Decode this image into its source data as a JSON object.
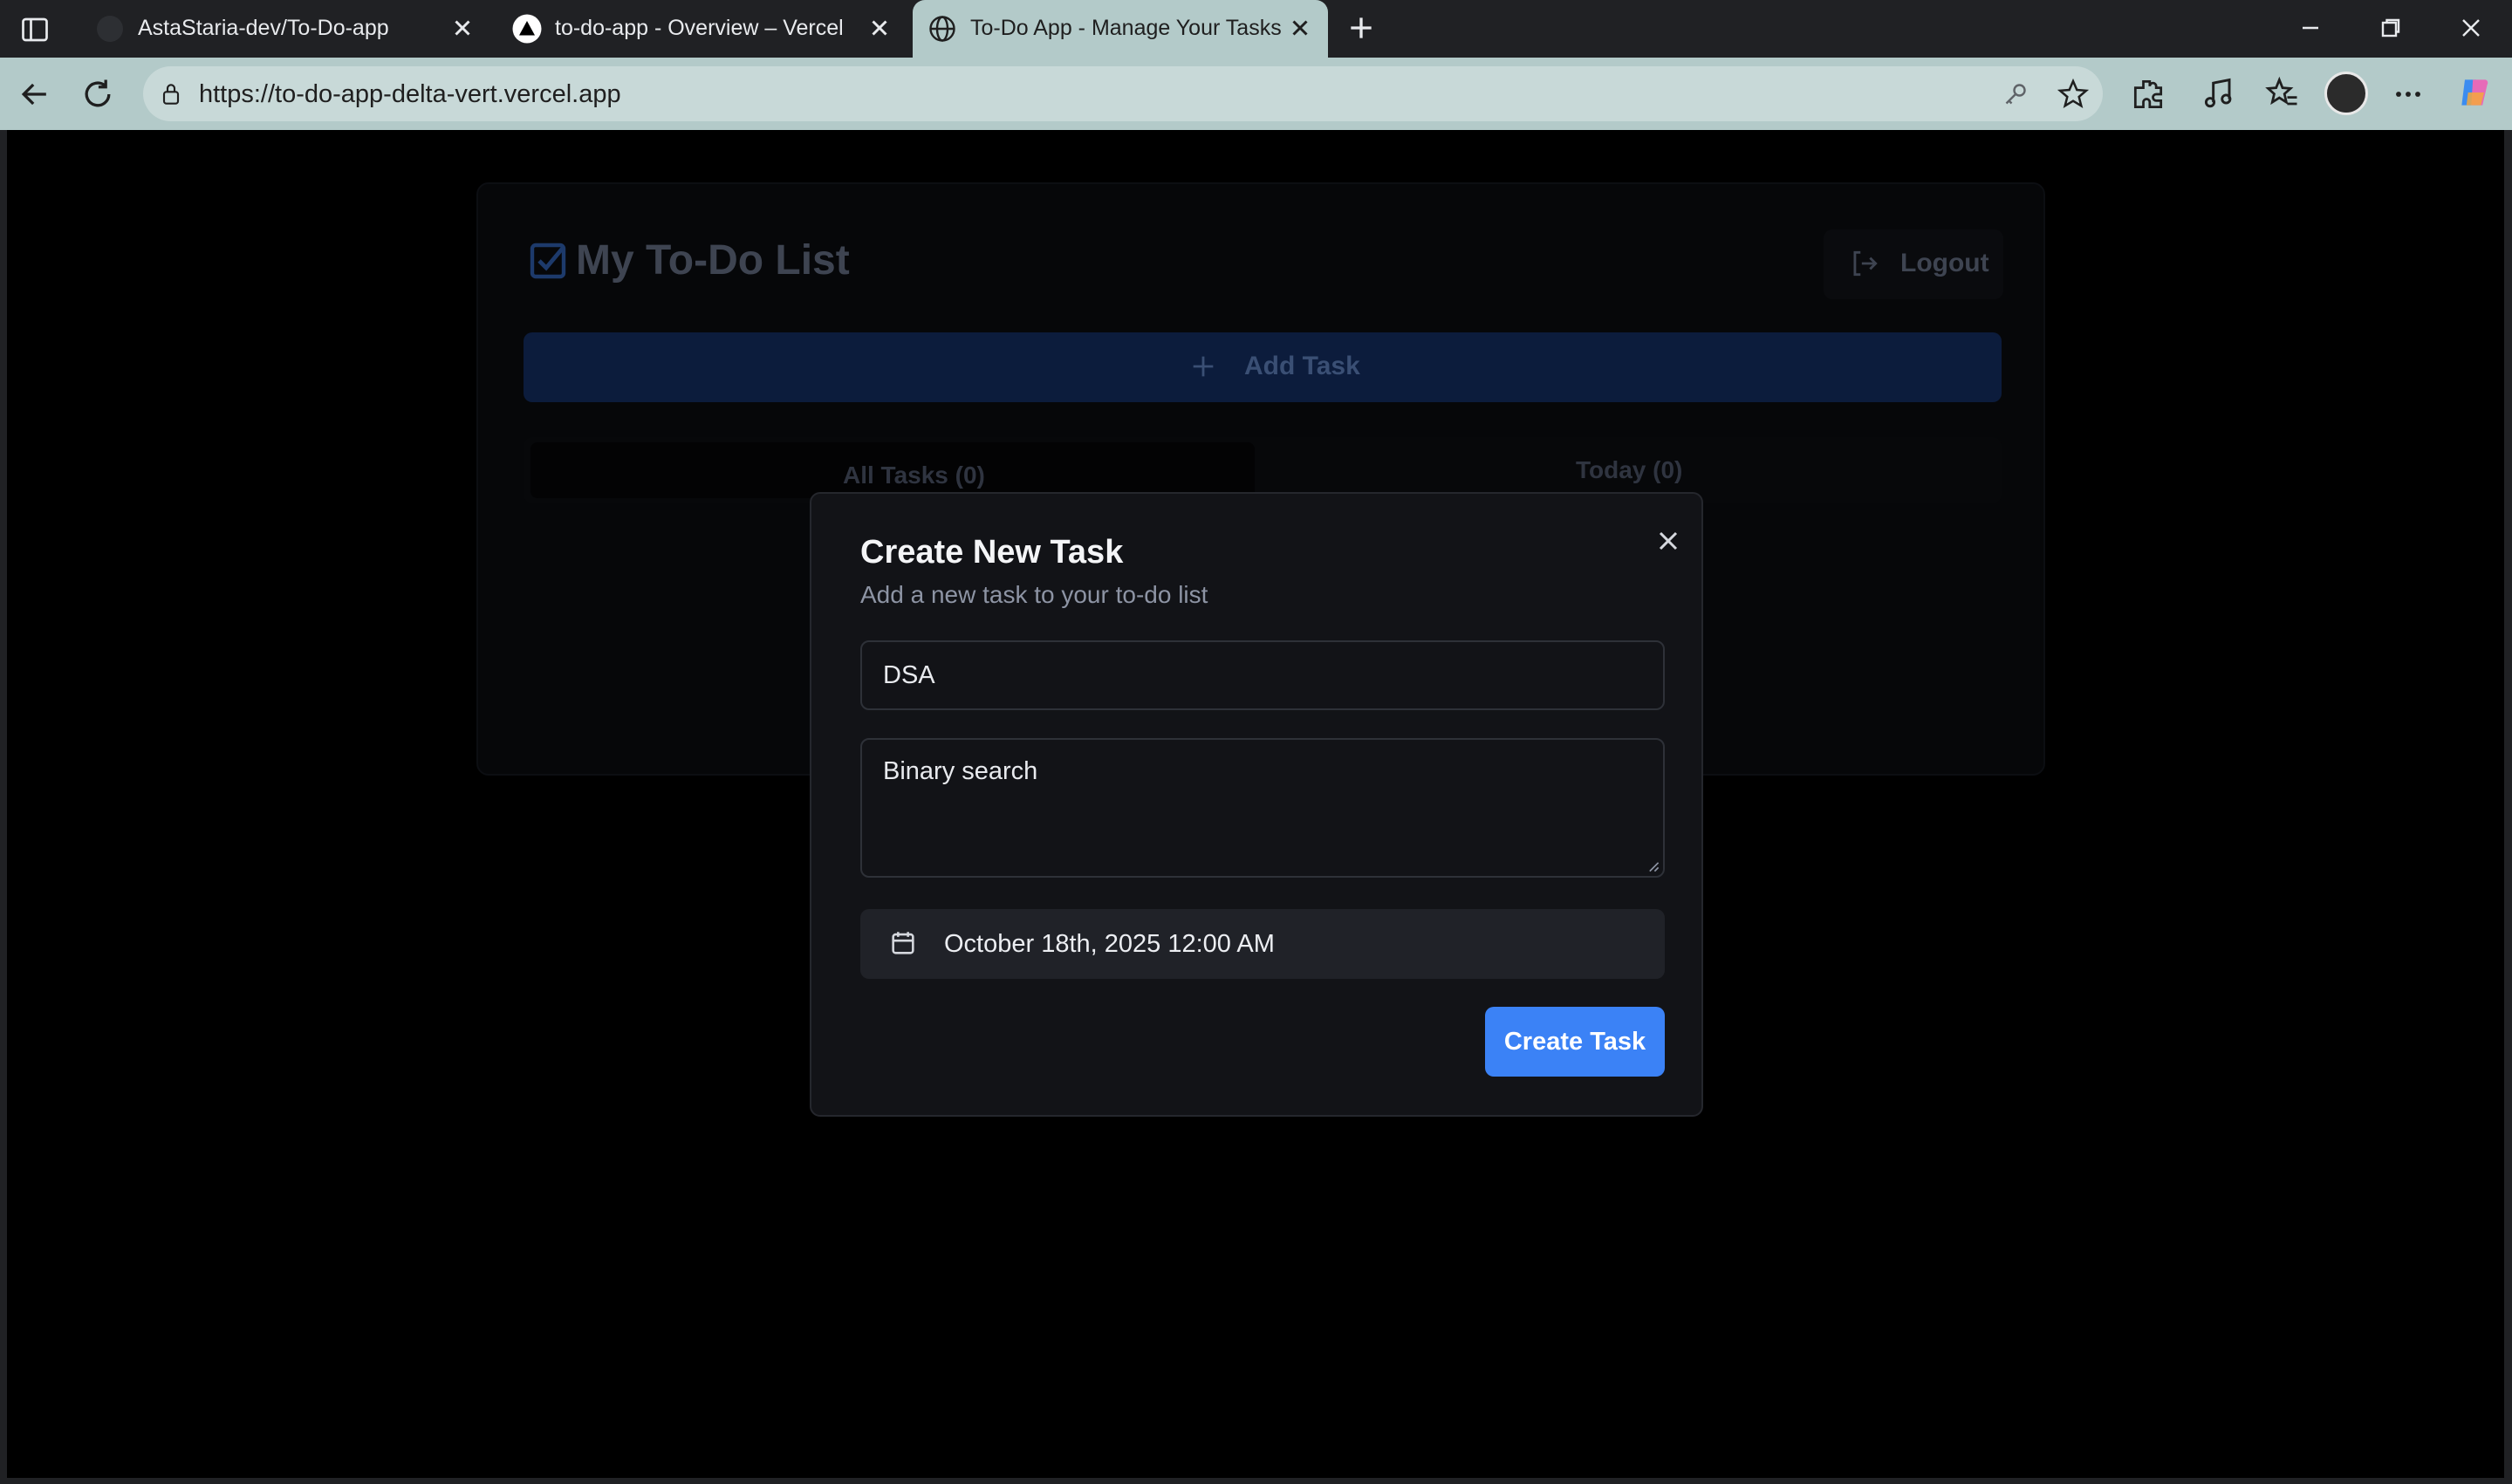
{
  "browser": {
    "tabs": [
      {
        "title": "AstaStaria-dev/To-Do-app",
        "icon": "github-icon",
        "active": false
      },
      {
        "title": "to-do-app - Overview – Vercel",
        "icon": "vercel-icon",
        "active": false
      },
      {
        "title": "To-Do App - Manage Your Tasks",
        "icon": "globe-icon",
        "active": true
      }
    ],
    "address_bar": {
      "url": "https://to-do-app-delta-vert.vercel.app"
    }
  },
  "app": {
    "title": "My To-Do List",
    "logout_label": "Logout",
    "add_task_label": "Add Task",
    "tabs": [
      {
        "label": "All Tasks (0)"
      },
      {
        "label": "Today (0)"
      }
    ]
  },
  "dialog": {
    "title": "Create New Task",
    "subtitle": "Add a new task to your to-do list",
    "title_field": {
      "value": "DSA"
    },
    "description_field": {
      "value": "Binary search"
    },
    "date_label": "October 18th, 2025 12:00 AM",
    "submit_label": "Create Task"
  },
  "colors": {
    "accent": "#3b82f6",
    "dialog_bg": "#121317",
    "toolbar_bg": "#b3cac9"
  }
}
